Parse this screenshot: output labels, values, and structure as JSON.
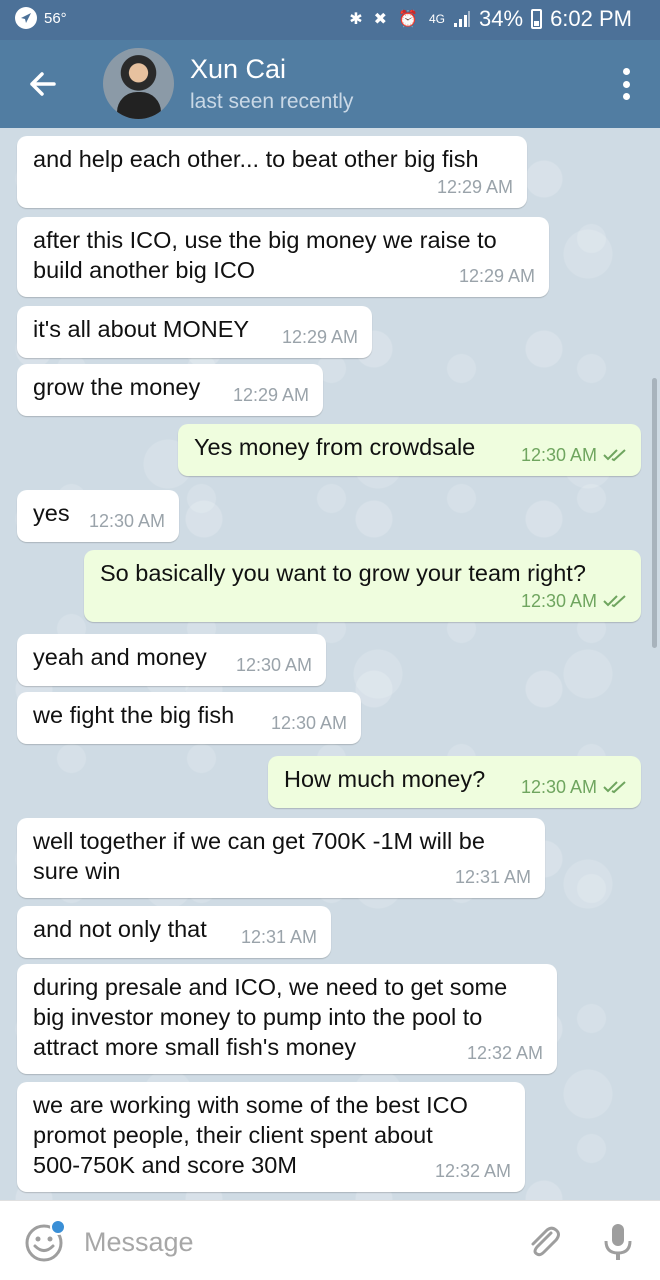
{
  "status_bar": {
    "temperature": "56°",
    "network": "4G",
    "battery": "34%",
    "time": "6:02 PM",
    "icons": [
      "bluetooth-icon",
      "mute-icon",
      "alarm-icon",
      "signal-icon",
      "battery-icon"
    ]
  },
  "header": {
    "contact_name": "Xun Cai",
    "status": "last seen recently",
    "icons": [
      "back-arrow-icon",
      "more-menu-icon"
    ]
  },
  "messages": [
    {
      "dir": "in",
      "text": "and help each other... to beat other big fish",
      "time": "12:29 AM"
    },
    {
      "dir": "in",
      "text": "after this ICO, use the big money we raise to\nbuild another big ICO",
      "time": "12:29 AM"
    },
    {
      "dir": "in",
      "text": "it's all about MONEY",
      "time": "12:29 AM"
    },
    {
      "dir": "in",
      "text": "grow the money",
      "time": "12:29 AM"
    },
    {
      "dir": "out",
      "text": "Yes money from crowdsale",
      "time": "12:30 AM"
    },
    {
      "dir": "in",
      "text": "yes",
      "time": "12:30 AM"
    },
    {
      "dir": "out",
      "text": "So basically you want to grow your team right?",
      "time": "12:30 AM"
    },
    {
      "dir": "in",
      "text": "yeah and money",
      "time": "12:30 AM"
    },
    {
      "dir": "in",
      "text": "we fight the big fish",
      "time": "12:30 AM"
    },
    {
      "dir": "out",
      "text": "How much money?",
      "time": "12:30 AM"
    },
    {
      "dir": "in",
      "text": "well together if we can get 700K -1M will be\nsure win",
      "time": "12:31 AM"
    },
    {
      "dir": "in",
      "text": "and not only that",
      "time": "12:31 AM"
    },
    {
      "dir": "in",
      "text": "during presale and ICO, we need to get some\nbig investor money to pump into the pool to\nattract more small fish's money",
      "time": "12:32 AM"
    },
    {
      "dir": "in",
      "text": "we are working with some of the best ICO\npromot people, their client spent about\n500-750K and score 30M",
      "time": "12:32 AM"
    }
  ],
  "input_bar": {
    "placeholder": "Message",
    "icons": [
      "emoji-icon",
      "attach-icon",
      "microphone-icon"
    ]
  },
  "colors": {
    "status_bar": "#4c7198",
    "header": "#517da2",
    "incoming_bubble": "#ffffff",
    "outgoing_bubble": "#effdde",
    "outgoing_time": "#6fa55f",
    "notify_dot": "#3a8fd6"
  }
}
